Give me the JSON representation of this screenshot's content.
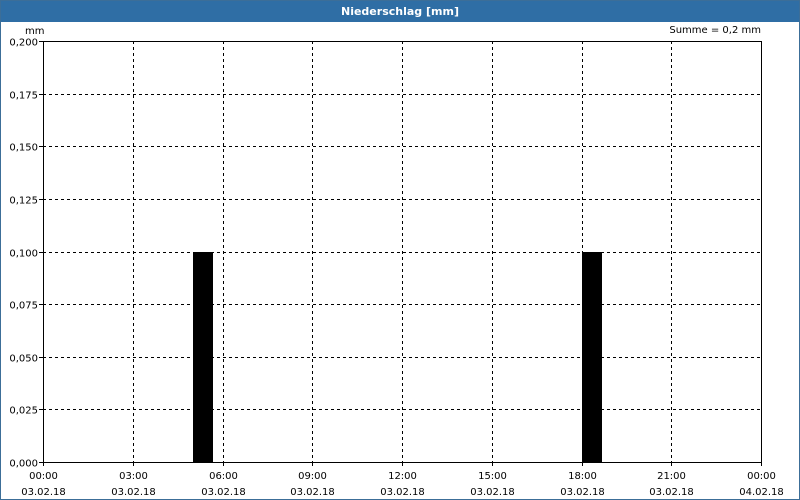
{
  "window": {
    "title": "Niederschlag [mm]"
  },
  "summary": {
    "text": "Summe = 0,2 mm"
  },
  "colors": {
    "title_bar": "#2f6ea5",
    "bar": "#000000",
    "grid": "#000000"
  },
  "chart_data": {
    "type": "bar",
    "title": "Niederschlag [mm]",
    "ylabel": "mm",
    "xlabel": "",
    "ylim": [
      0,
      0.2
    ],
    "xlim": [
      "2018-02-03 00:00",
      "2018-02-04 00:00"
    ],
    "yticks": [
      {
        "value": 0,
        "label": "0,000"
      },
      {
        "value": 0.025,
        "label": "0,025"
      },
      {
        "value": 0.05,
        "label": "0,050"
      },
      {
        "value": 0.075,
        "label": "0,075"
      },
      {
        "value": 0.1,
        "label": "0,100"
      },
      {
        "value": 0.125,
        "label": "0,125"
      },
      {
        "value": 0.15,
        "label": "0,150"
      },
      {
        "value": 0.175,
        "label": "0,175"
      },
      {
        "value": 0.2,
        "label": "0,200"
      }
    ],
    "xticks": [
      {
        "time": "00:00",
        "date": "03.02.18"
      },
      {
        "time": "03:00",
        "date": "03.02.18"
      },
      {
        "time": "06:00",
        "date": "03.02.18"
      },
      {
        "time": "09:00",
        "date": "03.02.18"
      },
      {
        "time": "12:00",
        "date": "03.02.18"
      },
      {
        "time": "15:00",
        "date": "03.02.18"
      },
      {
        "time": "18:00",
        "date": "03.02.18"
      },
      {
        "time": "21:00",
        "date": "03.02.18"
      },
      {
        "time": "00:00",
        "date": "04.02.18"
      }
    ],
    "bars": [
      {
        "start": "2018-02-03 05:00",
        "end": "2018-02-03 05:40",
        "value": 0.1
      },
      {
        "start": "2018-02-03 18:00",
        "end": "2018-02-03 18:40",
        "value": 0.1
      }
    ],
    "grid": true,
    "annotation": "Summe = 0,2 mm"
  }
}
